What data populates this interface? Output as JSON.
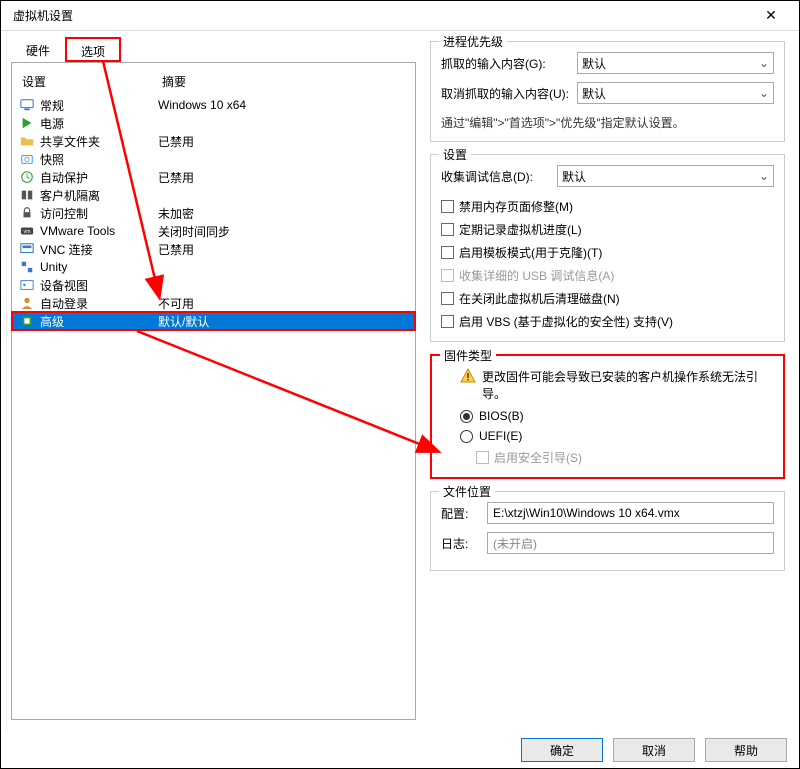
{
  "window": {
    "title": "虚拟机设置"
  },
  "tabs": {
    "hardware": "硬件",
    "options": "选项"
  },
  "list": {
    "header_setting": "设置",
    "header_summary": "摘要",
    "rows": [
      {
        "label": "常规",
        "summary": "Windows 10 x64"
      },
      {
        "label": "电源",
        "summary": ""
      },
      {
        "label": "共享文件夹",
        "summary": "已禁用"
      },
      {
        "label": "快照",
        "summary": ""
      },
      {
        "label": "自动保护",
        "summary": "已禁用"
      },
      {
        "label": "客户机隔离",
        "summary": ""
      },
      {
        "label": "访问控制",
        "summary": "未加密"
      },
      {
        "label": "VMware Tools",
        "summary": "关闭时间同步"
      },
      {
        "label": "VNC 连接",
        "summary": "已禁用"
      },
      {
        "label": "Unity",
        "summary": ""
      },
      {
        "label": "设备视图",
        "summary": ""
      },
      {
        "label": "自动登录",
        "summary": "不可用"
      },
      {
        "label": "高级",
        "summary": "默认/默认"
      }
    ]
  },
  "priority": {
    "group_title": "进程优先级",
    "grab_label": "抓取的输入内容(G):",
    "grab_value": "默认",
    "ungrab_label": "取消抓取的输入内容(U):",
    "ungrab_value": "默认",
    "hint": "通过\"编辑\">\"首选项\">\"优先级\"指定默认设置。"
  },
  "settings": {
    "group_title": "设置",
    "debug_label": "收集调试信息(D):",
    "debug_value": "默认",
    "cb_mem": "禁用内存页面修整(M)",
    "cb_log": "定期记录虚拟机进度(L)",
    "cb_template": "启用模板模式(用于克隆)(T)",
    "cb_usb": "收集详细的 USB 调试信息(A)",
    "cb_clean": "在关闭此虚拟机后清理磁盘(N)",
    "cb_vbs": "启用 VBS (基于虚拟化的安全性) 支持(V)"
  },
  "firmware": {
    "group_title": "固件类型",
    "warning": "更改固件可能会导致已安装的客户机操作系统无法引导。",
    "bios": "BIOS(B)",
    "uefi": "UEFI(E)",
    "secure_boot": "启用安全引导(S)"
  },
  "filelocation": {
    "group_title": "文件位置",
    "config_label": "配置:",
    "config_value": "E:\\xtzj\\Win10\\Windows 10 x64.vmx",
    "log_label": "日志:",
    "log_value": "(未开启)"
  },
  "buttons": {
    "ok": "确定",
    "cancel": "取消",
    "help": "帮助"
  }
}
